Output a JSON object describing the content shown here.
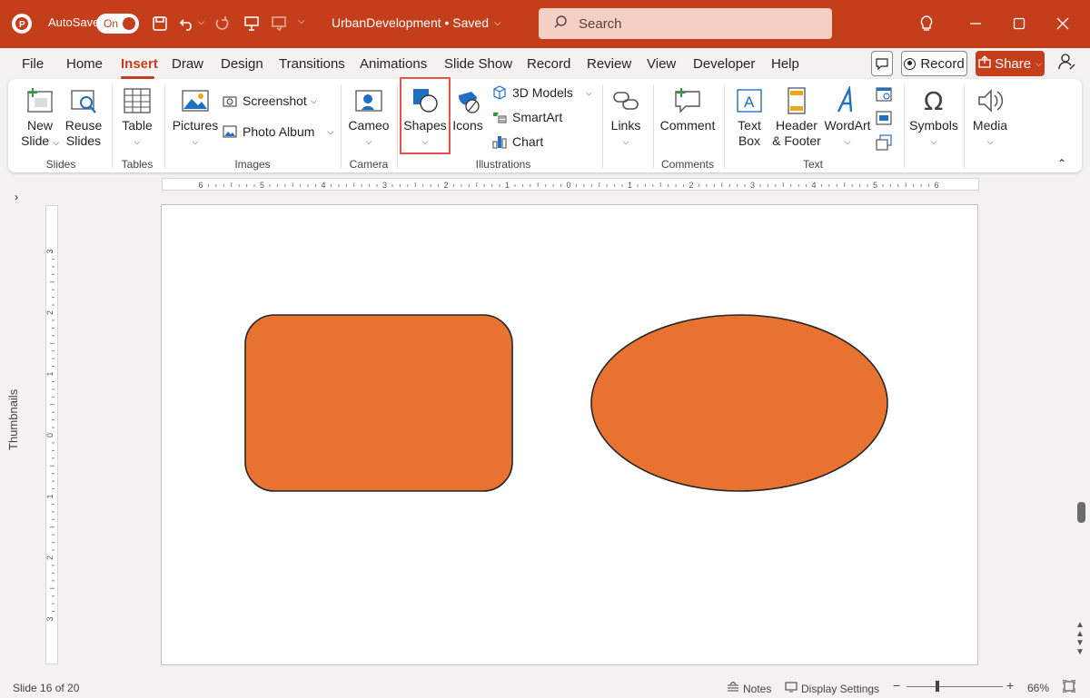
{
  "titlebar": {
    "autosave_label": "AutoSave",
    "autosave_state": "On",
    "document_title": "UrbanDevelopment • Saved",
    "search_placeholder": "Search"
  },
  "menu": {
    "tabs": [
      "File",
      "Home",
      "Insert",
      "Draw",
      "Design",
      "Transitions",
      "Animations",
      "Slide Show",
      "Record",
      "Review",
      "View",
      "Developer",
      "Help"
    ],
    "active_tab": "Insert",
    "record_label": "Record",
    "share_label": "Share"
  },
  "ribbon": {
    "slides": {
      "new_slide_1": "New",
      "new_slide_2": "Slide",
      "reuse_1": "Reuse",
      "reuse_2": "Slides",
      "group": "Slides"
    },
    "tables": {
      "table": "Table",
      "group": "Tables"
    },
    "images": {
      "pictures": "Pictures",
      "screenshot": "Screenshot",
      "photo_album": "Photo Album",
      "group": "Images"
    },
    "camera": {
      "cameo": "Cameo",
      "group": "Camera"
    },
    "illustrations": {
      "shapes": "Shapes",
      "icons": "Icons",
      "models": "3D Models",
      "smartart": "SmartArt",
      "chart": "Chart",
      "group": "Illustrations"
    },
    "links": {
      "links": "Links"
    },
    "comments": {
      "comment": "Comment",
      "group": "Comments"
    },
    "text": {
      "textbox_1": "Text",
      "textbox_2": "Box",
      "header_1": "Header",
      "header_2": "& Footer",
      "wordart": "WordArt",
      "group": "Text"
    },
    "symbols": {
      "symbols": "Symbols"
    },
    "media": {
      "media": "Media"
    }
  },
  "workspace": {
    "thumbnails_label": "Thumbnails",
    "hruler_labels": [
      "6",
      "5",
      "4",
      "3",
      "2",
      "1",
      "0",
      "1",
      "2",
      "3",
      "4",
      "5",
      "6"
    ],
    "vruler_labels": [
      "3",
      "2",
      "1",
      "0",
      "1",
      "2",
      "3"
    ],
    "shape_fill": "#e87330",
    "shape_stroke": "#262626"
  },
  "status": {
    "slide_info": "Slide 16 of 20",
    "notes": "Notes",
    "display_settings": "Display Settings",
    "zoom": "66%"
  },
  "colors": {
    "accent": "#c43e1c",
    "highlight": "#e8524a"
  }
}
